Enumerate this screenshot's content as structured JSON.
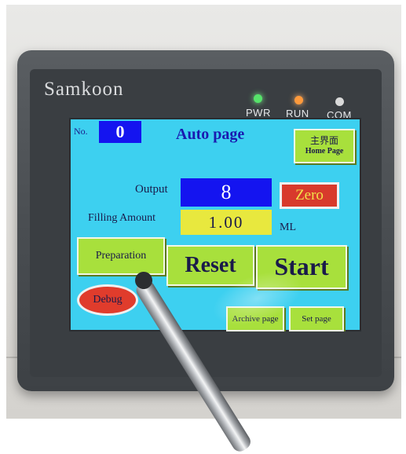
{
  "device": {
    "brand": "Samkoon",
    "indicators": [
      {
        "label": "PWR",
        "color": "#56e36a"
      },
      {
        "label": "RUN",
        "color": "#ff9a3c"
      },
      {
        "label": "COM",
        "color": "#d9d9d9"
      }
    ]
  },
  "screen": {
    "no_label": "No.",
    "no_value": "0",
    "title": "Auto page",
    "home_button": {
      "line1": "主界面",
      "line2": "Home Page"
    },
    "output_label": "Output",
    "output_value": "8",
    "zero_button": "Zero",
    "filling_label": "Filling Amount",
    "filling_value": "1.00",
    "filling_unit": "ML",
    "preparation_button": "Preparation",
    "reset_button": "Reset",
    "start_button": "Start",
    "debug_button": "Debug",
    "archive_button": "Archive page",
    "set_button": "Set page"
  },
  "colors": {
    "screen_bg": "#3dd0f0",
    "button_green": "#a8e03c",
    "value_blue": "#1414f0",
    "value_yellow": "#e8e83e",
    "button_red": "#d83a2c"
  }
}
